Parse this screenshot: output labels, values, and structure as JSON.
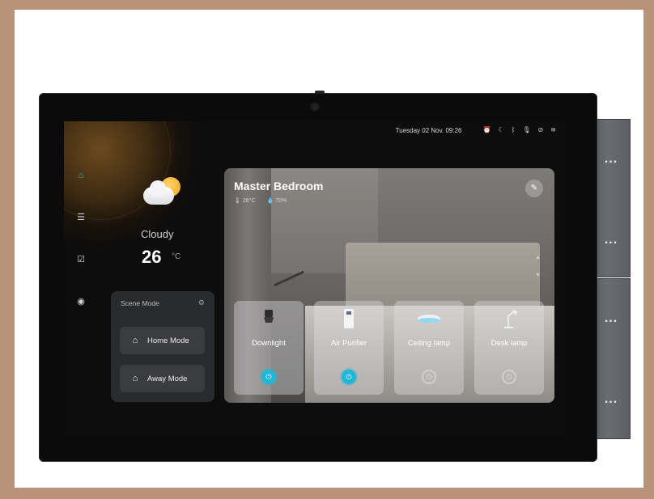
{
  "status_bar": {
    "datetime": "Tuesday 02 Nov. 09:26",
    "icons": [
      "alarm-icon",
      "moon-icon",
      "bluetooth-icon",
      "mic-off-icon",
      "security-icon",
      "wifi-icon"
    ]
  },
  "nav": {
    "items": [
      {
        "name": "home-icon",
        "active": true
      },
      {
        "name": "devices-icon",
        "active": false
      },
      {
        "name": "tasks-icon",
        "active": false
      },
      {
        "name": "camera-icon",
        "active": false
      }
    ]
  },
  "weather": {
    "condition": "Cloudy",
    "temperature": "26",
    "unit": "°C"
  },
  "scene_mode": {
    "title": "Scene Mode",
    "modes": [
      {
        "label": "Home Mode",
        "icon": "home-mode-icon"
      },
      {
        "label": "Away Mode",
        "icon": "away-mode-icon"
      }
    ]
  },
  "room": {
    "title": "Master Bedroom",
    "temperature": "26°C",
    "humidity": "70%",
    "devices": [
      {
        "label": "Downlight",
        "icon": "downlight-icon",
        "on": true
      },
      {
        "label": "Air Purifier",
        "icon": "air-purifier-icon",
        "on": true
      },
      {
        "label": "Ceiling lamp",
        "icon": "ceiling-lamp-icon",
        "on": false
      },
      {
        "label": "Desk lamp",
        "icon": "desk-lamp-icon",
        "on": false
      }
    ]
  },
  "side_switch": {
    "dots": "..."
  },
  "colors": {
    "accent": "#22b6d6",
    "frame": "#b8937a",
    "screen_bg": "#0d0d0e"
  }
}
